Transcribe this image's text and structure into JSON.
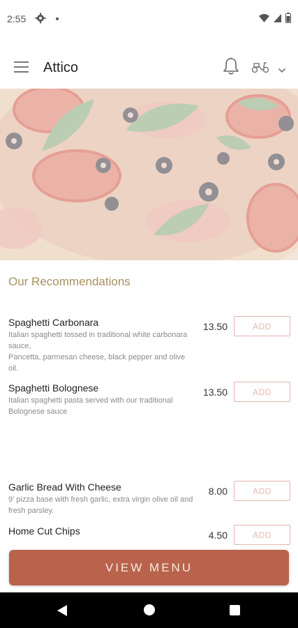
{
  "status_bar": {
    "time": "2:55",
    "icons": [
      "gear-icon",
      "notification-dot",
      "wifi-icon",
      "cell-signal-icon",
      "battery-icon"
    ]
  },
  "app_bar": {
    "title": "Attico",
    "icons": [
      "menu-icon",
      "bell-icon",
      "scooter-icon",
      "chevron-down-icon"
    ]
  },
  "hero": {
    "image": "pizza-photo"
  },
  "recommendations": {
    "title": "Our Recommendations",
    "items": [
      {
        "name": "Spaghetti Carbonara",
        "description": "Italian spaghetti tossed in traditional white carbonara sauce,\nPancetta, parmesan cheese, black pepper and olive oil.",
        "price": "13.50",
        "add_label": "ADD"
      },
      {
        "name": "Spaghetti Bolognese",
        "description": "Italian spaghetti pasta served with our traditional Bolognese sauce",
        "price": "13.50",
        "add_label": "ADD"
      },
      {
        "name": "Garlic Bread With Cheese",
        "description": "9' pizza base with fresh garlic, extra virgin olive oil and fresh parsley.",
        "price": "8.00",
        "add_label": "ADD"
      },
      {
        "name": "Home Cut Chips",
        "description": "",
        "price": "4.50",
        "add_label": "ADD"
      }
    ]
  },
  "footer": {
    "view_menu_label": "VIEW MENU"
  },
  "colors": {
    "accent": "#b9634c",
    "section_title": "#a89062",
    "add_border": "#e2b4ae"
  }
}
